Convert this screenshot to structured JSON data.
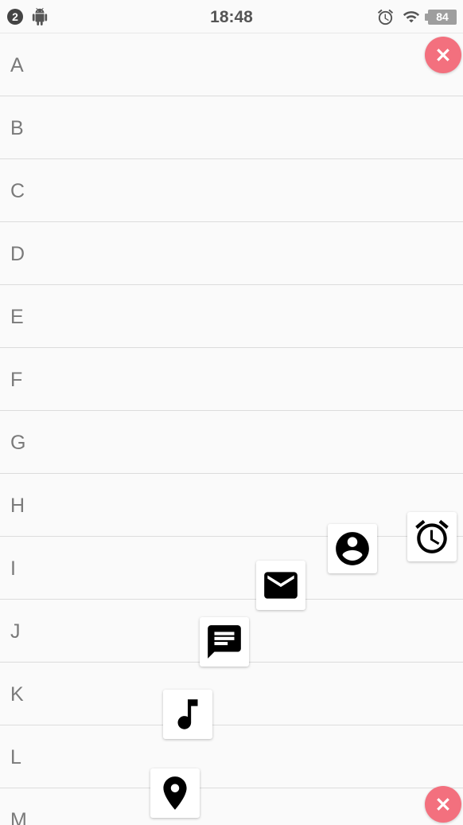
{
  "status_bar": {
    "notification_count": "2",
    "time": "18:48",
    "battery": "84",
    "icons": [
      "android-icon",
      "alarm-icon",
      "wifi-icon",
      "battery-icon"
    ]
  },
  "list": {
    "items": [
      "A",
      "B",
      "C",
      "D",
      "E",
      "F",
      "G",
      "H",
      "I",
      "J",
      "K",
      "L",
      "M"
    ]
  },
  "menu": {
    "close_buttons": [
      "close-icon",
      "close-icon"
    ],
    "items": [
      "alarm-icon",
      "account-icon",
      "mail-icon",
      "message-icon",
      "music-note-icon",
      "location-pin-icon"
    ]
  },
  "colors": {
    "close_button": "#f3707e",
    "background": "#fafafa",
    "divider": "#dcdcdc"
  }
}
